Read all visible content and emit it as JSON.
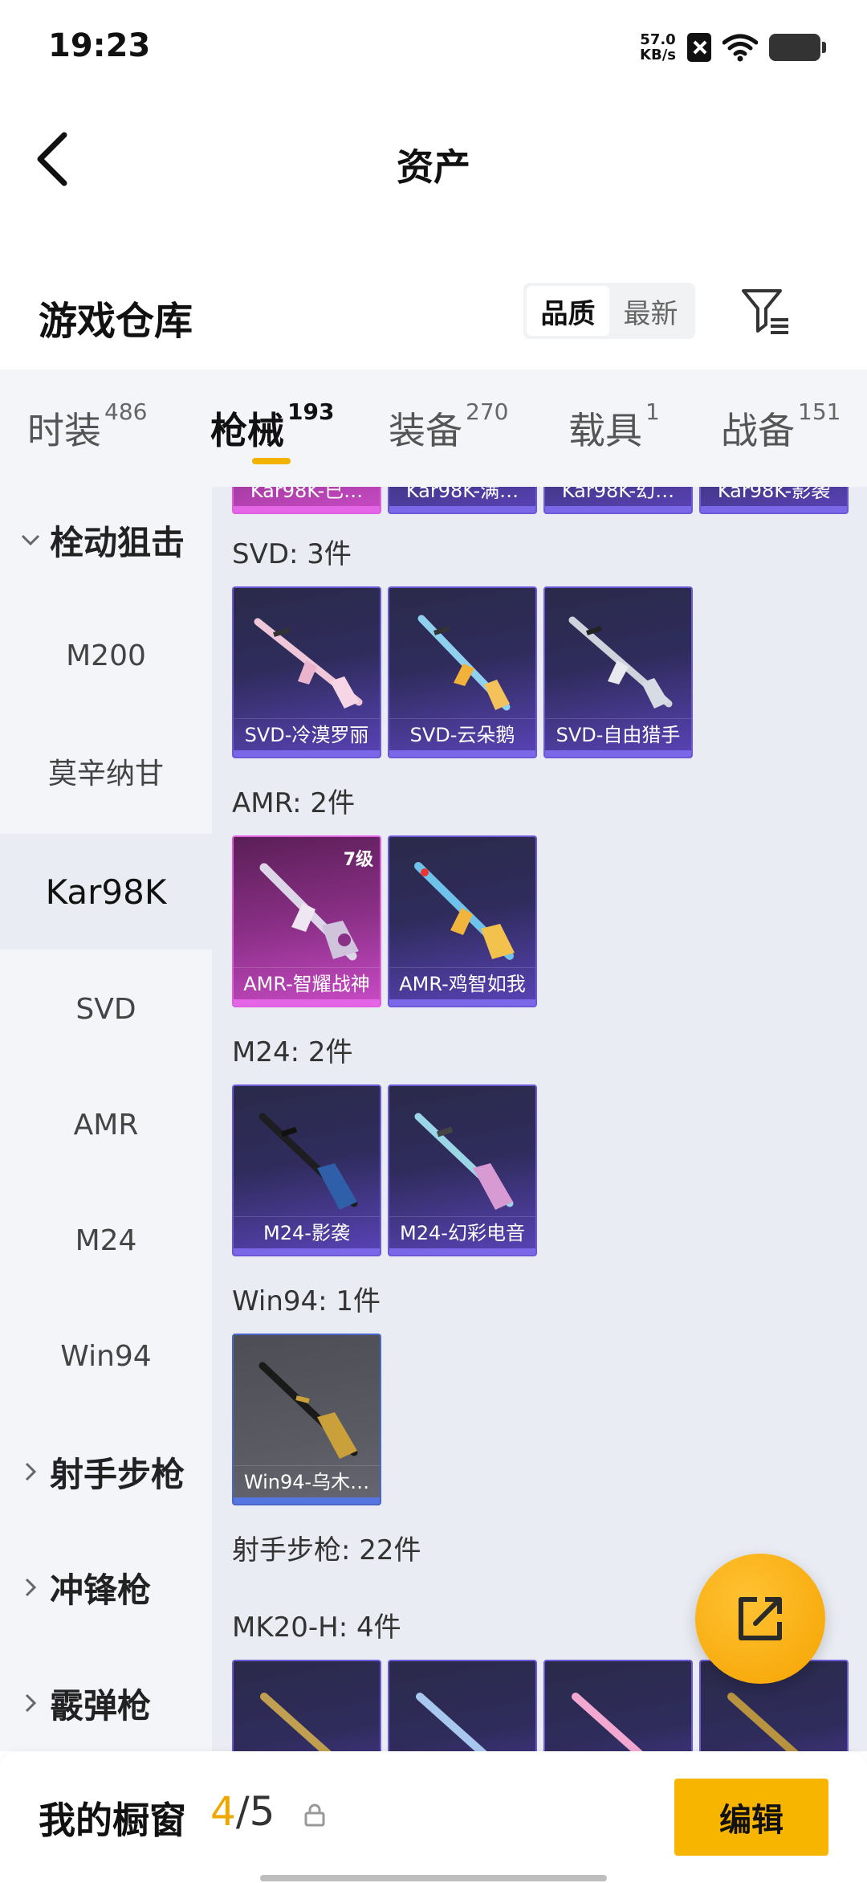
{
  "status_bar": {
    "time": "19:23",
    "net_speed_value": "57.0",
    "net_speed_unit": "KB/s"
  },
  "nav": {
    "title": "资产"
  },
  "warehouse": {
    "title": "游戏仓库",
    "sort_options": [
      "品质",
      "最新"
    ],
    "active_sort": "品质"
  },
  "tabs": [
    {
      "label": "时装",
      "count": "486"
    },
    {
      "label": "枪械",
      "count": "193",
      "active": true
    },
    {
      "label": "装备",
      "count": "270"
    },
    {
      "label": "载具",
      "count": "1"
    },
    {
      "label": "战备",
      "count": "151"
    }
  ],
  "sidebar": {
    "items": [
      {
        "label": "栓动狙击",
        "type": "group",
        "expanded": true
      },
      {
        "label": "M200"
      },
      {
        "label": "莫辛纳甘"
      },
      {
        "label": "Kar98K",
        "selected": true
      },
      {
        "label": "SVD"
      },
      {
        "label": "AMR"
      },
      {
        "label": "M24"
      },
      {
        "label": "Win94"
      },
      {
        "label": "射手步枪",
        "type": "group"
      },
      {
        "label": "冲锋枪",
        "type": "group"
      },
      {
        "label": "霰弹枪",
        "type": "group"
      }
    ]
  },
  "content": {
    "partial_cards": [
      "Kar98K-已…",
      "Kar98K-满…",
      "Kar98K-幻…",
      "Kar98K-影袭"
    ],
    "groups": {
      "svd": {
        "label": "SVD: 3件",
        "items": [
          "SVD-冷漠罗丽",
          "SVD-云朵鹅",
          "SVD-自由猎手"
        ]
      },
      "amr": {
        "label": "AMR: 2件",
        "items": [
          "AMR-智耀战神",
          "AMR-鸡智如我"
        ],
        "level_badge": "7级"
      },
      "m24": {
        "label": "M24: 2件",
        "items": [
          "M24-影袭",
          "M24-幻彩电音"
        ]
      },
      "win94": {
        "label": "Win94: 1件",
        "items": [
          "Win94-乌木…"
        ]
      },
      "marksman": {
        "label": "射手步枪: 22件"
      },
      "mk20": {
        "label": "MK20-H: 4件"
      }
    }
  },
  "showcase": {
    "label": "我的橱窗",
    "current": "4",
    "separator": "/",
    "total": "5",
    "edit_label": "编辑"
  },
  "colors": {
    "accent": "#f8b500",
    "epic": "#6d58d8",
    "legendary": "#e05ee0"
  }
}
